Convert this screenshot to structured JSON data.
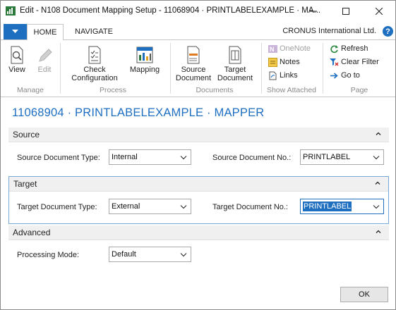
{
  "window": {
    "title": "Edit - N108 Document Mapping Setup - 11068904 · PRINTLABELEXAMPLE · MA..."
  },
  "tabs": {
    "home": "HOME",
    "navigate": "NAVIGATE",
    "company": "CRONUS International Ltd.",
    "help": "?"
  },
  "ribbon": {
    "manage": {
      "label": "Manage",
      "view": "View",
      "edit": "Edit"
    },
    "process": {
      "label": "Process",
      "check_configuration": "Check\nConfiguration",
      "check_configuration_line1": "Check",
      "check_configuration_line2": "Configuration",
      "mapping": "Mapping"
    },
    "documents": {
      "label": "Documents",
      "source_line1": "Source",
      "source_line2": "Document",
      "target_line1": "Target",
      "target_line2": "Document"
    },
    "show_attached": {
      "label": "Show Attached",
      "onenote": "OneNote",
      "notes": "Notes",
      "links": "Links"
    },
    "page": {
      "label": "Page",
      "refresh": "Refresh",
      "clear_filter": "Clear Filter",
      "go_to": "Go to"
    }
  },
  "page_title": "11068904 · PRINTLABELEXAMPLE · MAPPER",
  "sections": {
    "source": {
      "title": "Source",
      "document_type_label": "Source Document Type:",
      "document_type_value": "Internal",
      "document_no_label": "Source Document No.:",
      "document_no_value": "PRINTLABEL"
    },
    "target": {
      "title": "Target",
      "document_type_label": "Target Document Type:",
      "document_type_value": "External",
      "document_no_label": "Target Document No.:",
      "document_no_value": "PRINTLABEL"
    },
    "advanced": {
      "title": "Advanced",
      "processing_mode_label": "Processing Mode:",
      "processing_mode_value": "Default"
    }
  },
  "footer": {
    "ok": "OK"
  },
  "colors": {
    "accent": "#1f6fc1",
    "section_header": "#f0f0f0",
    "disabled_text": "#a0a0a0"
  }
}
